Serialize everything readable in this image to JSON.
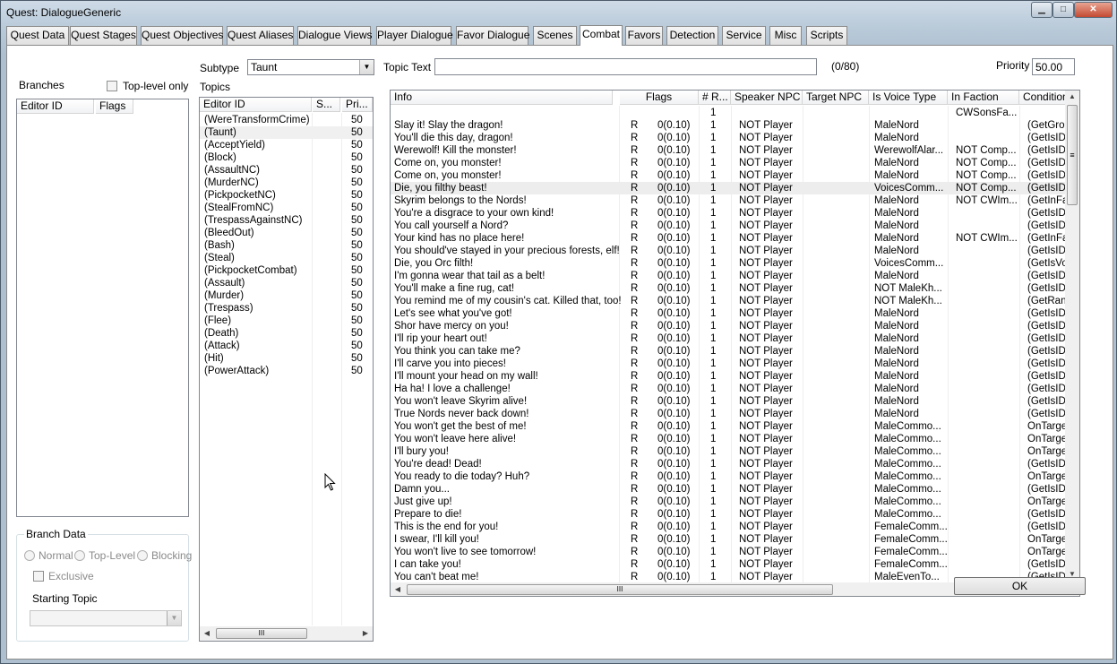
{
  "window": {
    "title": "Quest: DialogueGeneric",
    "close_glyph": "✕",
    "min_glyph": "▁",
    "max_glyph": "□"
  },
  "tabs": [
    "Quest Data",
    "Quest Stages",
    "Quest Objectives",
    "Quest Aliases",
    "Dialogue Views",
    "Player Dialogue",
    "Favor Dialogue",
    "Scenes",
    "Combat",
    "Favors",
    "Detection",
    "Service",
    "Misc",
    "Scripts"
  ],
  "active_tab": "Combat",
  "branches": {
    "label": "Branches",
    "toplevel_label": "Top-level only",
    "columns": [
      "Editor ID",
      "Flags"
    ]
  },
  "branch_data": {
    "legend": "Branch Data",
    "radio_normal": "Normal",
    "radio_toplevel": "Top-Level",
    "radio_blocking": "Blocking",
    "exclusive_label": "Exclusive",
    "starting_topic_label": "Starting Topic"
  },
  "subtype": {
    "label": "Subtype",
    "value": "Taunt"
  },
  "topics": {
    "label": "Topics",
    "columns": [
      "Editor ID",
      "S...",
      "Pri..."
    ],
    "selected_index": 1,
    "items": [
      {
        "id": "(WereTransformCrime)",
        "priority": "50"
      },
      {
        "id": "(Taunt)",
        "priority": "50"
      },
      {
        "id": "(AcceptYield)",
        "priority": "50"
      },
      {
        "id": "(Block)",
        "priority": "50"
      },
      {
        "id": "(AssaultNC)",
        "priority": "50"
      },
      {
        "id": "(MurderNC)",
        "priority": "50"
      },
      {
        "id": "(PickpocketNC)",
        "priority": "50"
      },
      {
        "id": "(StealFromNC)",
        "priority": "50"
      },
      {
        "id": "(TrespassAgainstNC)",
        "priority": "50"
      },
      {
        "id": "(BleedOut)",
        "priority": "50"
      },
      {
        "id": "(Bash)",
        "priority": "50"
      },
      {
        "id": "(Steal)",
        "priority": "50"
      },
      {
        "id": "(PickpocketCombat)",
        "priority": "50"
      },
      {
        "id": "(Assault)",
        "priority": "50"
      },
      {
        "id": "(Murder)",
        "priority": "50"
      },
      {
        "id": "(Trespass)",
        "priority": "50"
      },
      {
        "id": "(Flee)",
        "priority": "50"
      },
      {
        "id": "(Death)",
        "priority": "50"
      },
      {
        "id": "(Attack)",
        "priority": "50"
      },
      {
        "id": "(Hit)",
        "priority": "50"
      },
      {
        "id": "(PowerAttack)",
        "priority": "50"
      }
    ]
  },
  "topic_text": {
    "label": "Topic Text",
    "value": "",
    "counter": "(0/80)"
  },
  "priority": {
    "label": "Priority",
    "value": "50.00"
  },
  "info": {
    "columns": [
      "Info",
      "Flags",
      "# R...",
      "Speaker NPC",
      "Target NPC",
      "Is Voice Type",
      "In Faction",
      "Condition"
    ],
    "selected_index": 6,
    "rows": [
      {
        "info": "",
        "flag": "",
        "range": "",
        "count": "1",
        "speaker": "",
        "target": "",
        "voice": "",
        "faction": "CWSonsFa...",
        "cond": ""
      },
      {
        "info": "Slay it! Slay the dragon!",
        "flag": "R",
        "range": "0(0.10)",
        "count": "1",
        "speaker": "NOT Player",
        "target": "",
        "voice": "MaleNord",
        "faction": "",
        "cond": "(GetGrou"
      },
      {
        "info": "You'll die this day, dragon!",
        "flag": "R",
        "range": "0(0.10)",
        "count": "1",
        "speaker": "NOT Player",
        "target": "",
        "voice": "MaleNord",
        "faction": "",
        "cond": "(GetIsID"
      },
      {
        "info": "Werewolf! Kill the monster!",
        "flag": "R",
        "range": "0(0.10)",
        "count": "1",
        "speaker": "NOT Player",
        "target": "",
        "voice": "WerewolfAlar...",
        "faction": "NOT Comp...",
        "cond": "(GetIsID"
      },
      {
        "info": "Come on, you monster!",
        "flag": "R",
        "range": "0(0.10)",
        "count": "1",
        "speaker": "NOT Player",
        "target": "",
        "voice": "MaleNord",
        "faction": "NOT Comp...",
        "cond": "(GetIsID"
      },
      {
        "info": "Come on, you monster!",
        "flag": "R",
        "range": "0(0.10)",
        "count": "1",
        "speaker": "NOT Player",
        "target": "",
        "voice": "MaleNord",
        "faction": "NOT Comp...",
        "cond": "(GetIsID"
      },
      {
        "info": "Die, you filthy beast!",
        "flag": "R",
        "range": "0(0.10)",
        "count": "1",
        "speaker": "NOT Player",
        "target": "",
        "voice": "VoicesComm...",
        "faction": "NOT Comp...",
        "cond": "(GetIsID"
      },
      {
        "info": "Skyrim belongs to the Nords!",
        "flag": "R",
        "range": "0(0.10)",
        "count": "1",
        "speaker": "NOT Player",
        "target": "",
        "voice": "MaleNord",
        "faction": "NOT CWIm...",
        "cond": "(GetInFa"
      },
      {
        "info": "You're a disgrace to your own kind!",
        "flag": "R",
        "range": "0(0.10)",
        "count": "1",
        "speaker": "NOT Player",
        "target": "",
        "voice": "MaleNord",
        "faction": "",
        "cond": "(GetIsID"
      },
      {
        "info": "You call yourself a Nord?",
        "flag": "R",
        "range": "0(0.10)",
        "count": "1",
        "speaker": "NOT Player",
        "target": "",
        "voice": "MaleNord",
        "faction": "",
        "cond": "(GetIsID"
      },
      {
        "info": "Your kind has no place here!",
        "flag": "R",
        "range": "0(0.10)",
        "count": "1",
        "speaker": "NOT Player",
        "target": "",
        "voice": "MaleNord",
        "faction": "NOT CWIm...",
        "cond": "(GetInFa"
      },
      {
        "info": "You should've stayed in your precious forests, elf!",
        "flag": "R",
        "range": "0(0.10)",
        "count": "1",
        "speaker": "NOT Player",
        "target": "",
        "voice": "MaleNord",
        "faction": "",
        "cond": "(GetIsID"
      },
      {
        "info": "Die, you Orc filth!",
        "flag": "R",
        "range": "0(0.10)",
        "count": "1",
        "speaker": "NOT Player",
        "target": "",
        "voice": "VoicesComm...",
        "faction": "",
        "cond": "(GetIsVo"
      },
      {
        "info": "I'm gonna wear that tail as a belt!",
        "flag": "R",
        "range": "0(0.10)",
        "count": "1",
        "speaker": "NOT Player",
        "target": "",
        "voice": "MaleNord",
        "faction": "",
        "cond": "(GetIsID"
      },
      {
        "info": "You'll make a fine rug, cat!",
        "flag": "R",
        "range": "0(0.10)",
        "count": "1",
        "speaker": "NOT Player",
        "target": "",
        "voice": "NOT MaleKh...",
        "faction": "",
        "cond": "(GetIsID"
      },
      {
        "info": "You remind me of my cousin's cat. Killed that, too!",
        "flag": "R",
        "range": "0(0.10)",
        "count": "1",
        "speaker": "NOT Player",
        "target": "",
        "voice": "NOT MaleKh...",
        "faction": "",
        "cond": "(GetRand"
      },
      {
        "info": "Let's see what you've got!",
        "flag": "R",
        "range": "0(0.10)",
        "count": "1",
        "speaker": "NOT Player",
        "target": "",
        "voice": "MaleNord",
        "faction": "",
        "cond": "(GetIsID"
      },
      {
        "info": "Shor have mercy on you!",
        "flag": "R",
        "range": "0(0.10)",
        "count": "1",
        "speaker": "NOT Player",
        "target": "",
        "voice": "MaleNord",
        "faction": "",
        "cond": "(GetIsID"
      },
      {
        "info": "I'll rip your heart out!",
        "flag": "R",
        "range": "0(0.10)",
        "count": "1",
        "speaker": "NOT Player",
        "target": "",
        "voice": "MaleNord",
        "faction": "",
        "cond": "(GetIsID"
      },
      {
        "info": "You think you can take me?",
        "flag": "R",
        "range": "0(0.10)",
        "count": "1",
        "speaker": "NOT Player",
        "target": "",
        "voice": "MaleNord",
        "faction": "",
        "cond": "(GetIsID"
      },
      {
        "info": "I'll carve you into pieces!",
        "flag": "R",
        "range": "0(0.10)",
        "count": "1",
        "speaker": "NOT Player",
        "target": "",
        "voice": "MaleNord",
        "faction": "",
        "cond": "(GetIsID"
      },
      {
        "info": "I'll mount your head on my wall!",
        "flag": "R",
        "range": "0(0.10)",
        "count": "1",
        "speaker": "NOT Player",
        "target": "",
        "voice": "MaleNord",
        "faction": "",
        "cond": "(GetIsID"
      },
      {
        "info": "Ha ha! I love a challenge!",
        "flag": "R",
        "range": "0(0.10)",
        "count": "1",
        "speaker": "NOT Player",
        "target": "",
        "voice": "MaleNord",
        "faction": "",
        "cond": "(GetIsID"
      },
      {
        "info": "You won't leave Skyrim alive!",
        "flag": "R",
        "range": "0(0.10)",
        "count": "1",
        "speaker": "NOT Player",
        "target": "",
        "voice": "MaleNord",
        "faction": "",
        "cond": "(GetIsID"
      },
      {
        "info": "True Nords never back down!",
        "flag": "R",
        "range": "0(0.10)",
        "count": "1",
        "speaker": "NOT Player",
        "target": "",
        "voice": "MaleNord",
        "faction": "",
        "cond": "(GetIsID"
      },
      {
        "info": "You won't get the best of me!",
        "flag": "R",
        "range": "0(0.10)",
        "count": "1",
        "speaker": "NOT Player",
        "target": "",
        "voice": "MaleCommo...",
        "faction": "",
        "cond": "OnTarge"
      },
      {
        "info": "You won't leave here alive!",
        "flag": "R",
        "range": "0(0.10)",
        "count": "1",
        "speaker": "NOT Player",
        "target": "",
        "voice": "MaleCommo...",
        "faction": "",
        "cond": "OnTarge"
      },
      {
        "info": "I'll bury you!",
        "flag": "R",
        "range": "0(0.10)",
        "count": "1",
        "speaker": "NOT Player",
        "target": "",
        "voice": "MaleCommo...",
        "faction": "",
        "cond": "OnTarge"
      },
      {
        "info": "You're dead! Dead!",
        "flag": "R",
        "range": "0(0.10)",
        "count": "1",
        "speaker": "NOT Player",
        "target": "",
        "voice": "MaleCommo...",
        "faction": "",
        "cond": "(GetIsID"
      },
      {
        "info": "You ready to die today? Huh?",
        "flag": "R",
        "range": "0(0.10)",
        "count": "1",
        "speaker": "NOT Player",
        "target": "",
        "voice": "MaleCommo...",
        "faction": "",
        "cond": "OnTarge"
      },
      {
        "info": "Damn you...",
        "flag": "R",
        "range": "0(0.10)",
        "count": "1",
        "speaker": "NOT Player",
        "target": "",
        "voice": "MaleCommo...",
        "faction": "",
        "cond": "(GetIsID"
      },
      {
        "info": "Just give up!",
        "flag": "R",
        "range": "0(0.10)",
        "count": "1",
        "speaker": "NOT Player",
        "target": "",
        "voice": "MaleCommo...",
        "faction": "",
        "cond": "OnTarge"
      },
      {
        "info": "Prepare to die!",
        "flag": "R",
        "range": "0(0.10)",
        "count": "1",
        "speaker": "NOT Player",
        "target": "",
        "voice": "MaleCommo...",
        "faction": "",
        "cond": "(GetIsID"
      },
      {
        "info": "This is the end for you!",
        "flag": "R",
        "range": "0(0.10)",
        "count": "1",
        "speaker": "NOT Player",
        "target": "",
        "voice": "FemaleComm...",
        "faction": "",
        "cond": "(GetIsID"
      },
      {
        "info": "I swear, I'll kill you!",
        "flag": "R",
        "range": "0(0.10)",
        "count": "1",
        "speaker": "NOT Player",
        "target": "",
        "voice": "FemaleComm...",
        "faction": "",
        "cond": "OnTarge"
      },
      {
        "info": "You won't live to see tomorrow!",
        "flag": "R",
        "range": "0(0.10)",
        "count": "1",
        "speaker": "NOT Player",
        "target": "",
        "voice": "FemaleComm...",
        "faction": "",
        "cond": "OnTarge"
      },
      {
        "info": "I can take you!",
        "flag": "R",
        "range": "0(0.10)",
        "count": "1",
        "speaker": "NOT Player",
        "target": "",
        "voice": "FemaleComm...",
        "faction": "",
        "cond": "(GetIsID"
      },
      {
        "info": "You can't beat me!",
        "flag": "R",
        "range": "0(0.10)",
        "count": "1",
        "speaker": "NOT Player",
        "target": "",
        "voice": "MaleEvenTo...",
        "faction": "",
        "cond": "(GetIsID"
      }
    ]
  },
  "ok_label": "OK",
  "scroll": {
    "grip": "III",
    "left": "◀",
    "right": "▶",
    "up": "▲",
    "down": "▼",
    "vgrip": "≡",
    "drop": "▼"
  },
  "colors": {
    "titlebar": "#c3d3e2",
    "close_red": "#c44a32",
    "selected_row": "#ededed"
  }
}
